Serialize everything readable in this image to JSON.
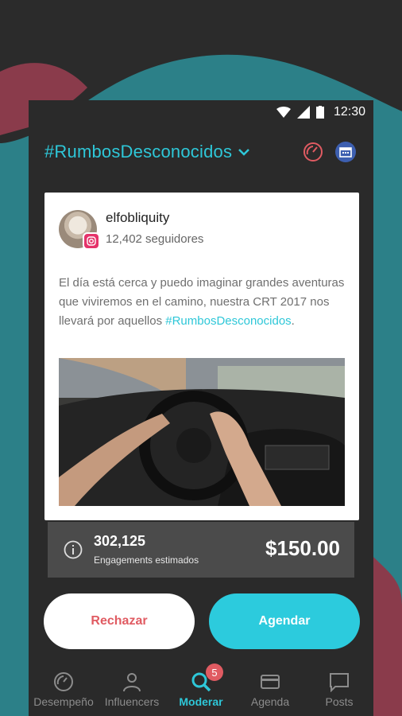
{
  "status_bar": {
    "time": "12:30"
  },
  "header": {
    "title": "#RumbosDesconocidos",
    "icons": [
      "chevron-down-icon",
      "gauge-icon",
      "calendar-icon"
    ]
  },
  "post": {
    "username": "elfobliquity",
    "followers": "12,402 seguidores",
    "caption_text": "El día está cerca y puedo imaginar grandes aventuras que viviremos en el camino, nuestra CRT 2017 nos llevará por aquellos ",
    "caption_hashtag": "#RumbosDesconocidos",
    "caption_end": "."
  },
  "stats": {
    "engagement_value": "302,125",
    "engagement_label": "Engagements estimados",
    "price": "$150.00"
  },
  "actions": {
    "reject_label": "Rechazar",
    "schedule_label": "Agendar"
  },
  "tabs": [
    {
      "label": "Desempeño",
      "icon": "gauge-icon"
    },
    {
      "label": "Influencers",
      "icon": "person-icon"
    },
    {
      "label": "Moderar",
      "icon": "search-icon",
      "badge": "5",
      "active": true
    },
    {
      "label": "Agenda",
      "icon": "card-icon"
    },
    {
      "label": "Posts",
      "icon": "chat-icon"
    }
  ],
  "colors": {
    "accent": "#2ec7d8",
    "reject": "#e05b62",
    "background": "#2a2a2a"
  }
}
